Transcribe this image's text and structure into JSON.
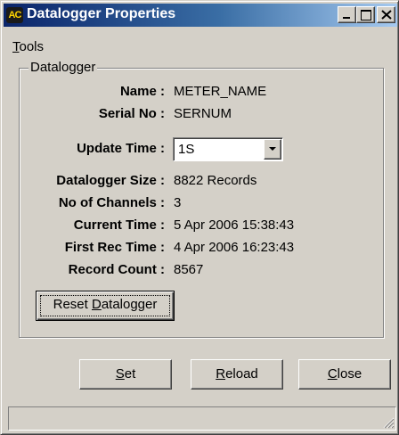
{
  "window": {
    "title": "Datalogger Properties",
    "icon_text": "AC"
  },
  "menu": {
    "tools_access_key": "T",
    "tools_rest": "ools"
  },
  "group": {
    "label": "Datalogger"
  },
  "fields": {
    "name_label": "Name :",
    "name_value": "METER_NAME",
    "serial_label": "Serial No :",
    "serial_value": "SERNUM",
    "update_label": "Update Time :",
    "update_value": "1S",
    "size_label": "Datalogger Size :",
    "size_value": "8822 Records",
    "channels_label": "No of Channels :",
    "channels_value": "3",
    "current_label": "Current Time :",
    "current_value": "5 Apr 2006 15:38:43",
    "first_label": "First Rec Time :",
    "first_value": "4 Apr 2006 16:23:43",
    "count_label": "Record Count :",
    "count_value": "8567"
  },
  "buttons": {
    "reset_a": "Reset ",
    "reset_key": "D",
    "reset_b": "atalogger",
    "set_key": "S",
    "set_rest": "et",
    "reload_key": "R",
    "reload_rest": "eload",
    "close_key": "C",
    "close_rest": "lose"
  },
  "status": {
    "text": ""
  },
  "icons": [
    "app-icon",
    "minimize-icon",
    "maximize-icon",
    "close-icon",
    "chevron-down-icon",
    "resize-grip-icon"
  ]
}
